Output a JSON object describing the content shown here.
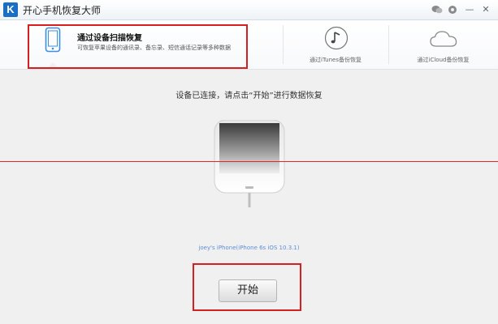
{
  "window": {
    "title": "开心手机恢复大师",
    "logo_letter": "K",
    "controls": {
      "chat_icon": "chat-icon",
      "settings_icon": "gear-icon",
      "minimize": "—",
      "close": "✕"
    }
  },
  "tabs": [
    {
      "title": "通过设备扫描恢复",
      "description": "可恢复苹果设备的通讯录、备忘录、短信通话记录等多种数据",
      "icon": "phone-icon",
      "active": true
    },
    {
      "label": "通过iTunes备份恢复",
      "icon": "music-note-icon"
    },
    {
      "label": "通过iCloud备份恢复",
      "icon": "cloud-icon"
    }
  ],
  "main": {
    "instruction": "设备已连接，请点击“开始”进行数据恢复",
    "device_name": "joey's iPhone(iPhone 6s iOS 10.3.1)",
    "start_button": "开始"
  },
  "colors": {
    "highlight_box": "#d62020",
    "redline": "#e32626",
    "device_name_text": "#5b8fd6",
    "logo_bg": "#1a6fc4"
  }
}
